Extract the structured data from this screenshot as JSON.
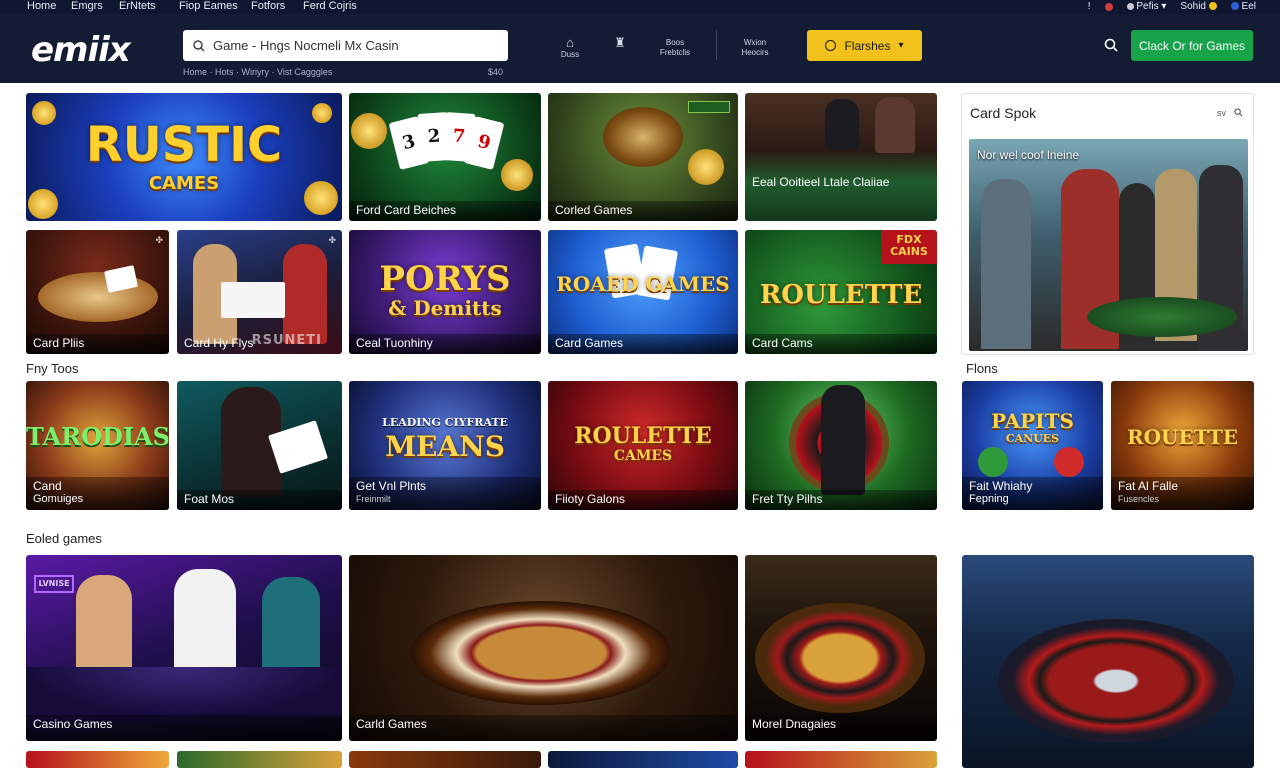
{
  "topbar": {
    "links": [
      "Home",
      "Emgrs",
      "ErNtets",
      "Fiop Eames",
      "Fotfors",
      "Ferd Cojris"
    ],
    "right_items": [
      "!",
      "Pefis",
      "Sohid",
      "Eel"
    ]
  },
  "header": {
    "logo": "emiix",
    "search_value": "Game - Hngs Nocmeli Mx Casin",
    "breadcrumb": "Home · Hots · Wiriyry · Vist Cagggles",
    "breadcrumb_count": "$40",
    "nav_icons": [
      {
        "label": "Duss",
        "icon": "home-icon"
      },
      {
        "label": "",
        "icon": "trophy-icon"
      },
      {
        "label": "Boos Frebtclis",
        "icon": "none"
      },
      {
        "label": "Wxion Heocirs",
        "icon": "none"
      }
    ],
    "promo_button": "Flarshes",
    "cta_button": "Clack Or for Games",
    "colors": {
      "header_bg": "#131c33",
      "promo": "#f3c11b",
      "cta": "#16a34a"
    }
  },
  "row1": [
    {
      "title": "RUSTIC",
      "title2": "CAMES",
      "caption": ""
    },
    {
      "title": "3 2 7 9",
      "caption": "Ford Card Beiches"
    },
    {
      "title": "",
      "caption": "Corled Games"
    },
    {
      "title": "",
      "caption": "Eeal Ooitieel Ltale Claiiae"
    }
  ],
  "row2": [
    {
      "title": "",
      "caption": "Card Pliis"
    },
    {
      "title": "",
      "caption": "Card Hy Flys",
      "overlay": "RSUNETI"
    },
    {
      "title": "PORYS",
      "title2": "& Demitts",
      "caption": "Ceal Tuonhiny"
    },
    {
      "title": "ROAED GAMES",
      "caption": "Card Games"
    },
    {
      "title": "ROULETTE",
      "badge": "FDX CAINS",
      "caption": "Card Cams"
    }
  ],
  "section_fny": "Fny Toos",
  "section_flons": "Flons",
  "row3": [
    {
      "title": "TARODIAS",
      "caption": "Cand",
      "sub": "Gomuiges"
    },
    {
      "title": "",
      "caption": "Foat Mos",
      "sub": ""
    },
    {
      "title": "LEADING CIYFRATE",
      "title2": "MEANS",
      "caption": "Get Vnl Plnts",
      "sub": "Freinmilt"
    },
    {
      "title": "ROULETTE",
      "title2": "CAMES",
      "caption": "Fiioty Galons",
      "sub": ""
    },
    {
      "title": "",
      "caption": "Fret Tty Pilhs",
      "sub": ""
    },
    {
      "title": "PAPITS",
      "title2": "CANUES",
      "caption": "Fait Whiahy",
      "sub": "Fepning"
    },
    {
      "title": "ROUETTE",
      "caption": "Fat Al Falle",
      "sub": "Fusencles"
    }
  ],
  "section_eoled": "Eoled games",
  "row4": [
    {
      "caption": "Casino Games",
      "sign": "LVNISE"
    },
    {
      "caption": "Carld Games"
    },
    {
      "caption": "Morel Dnagaies"
    },
    {
      "caption": ""
    }
  ],
  "sidebar": {
    "title": "Card Spok",
    "icons": [
      "sv",
      "search-icon"
    ],
    "image_caption": "Nor wel coof lneine"
  }
}
